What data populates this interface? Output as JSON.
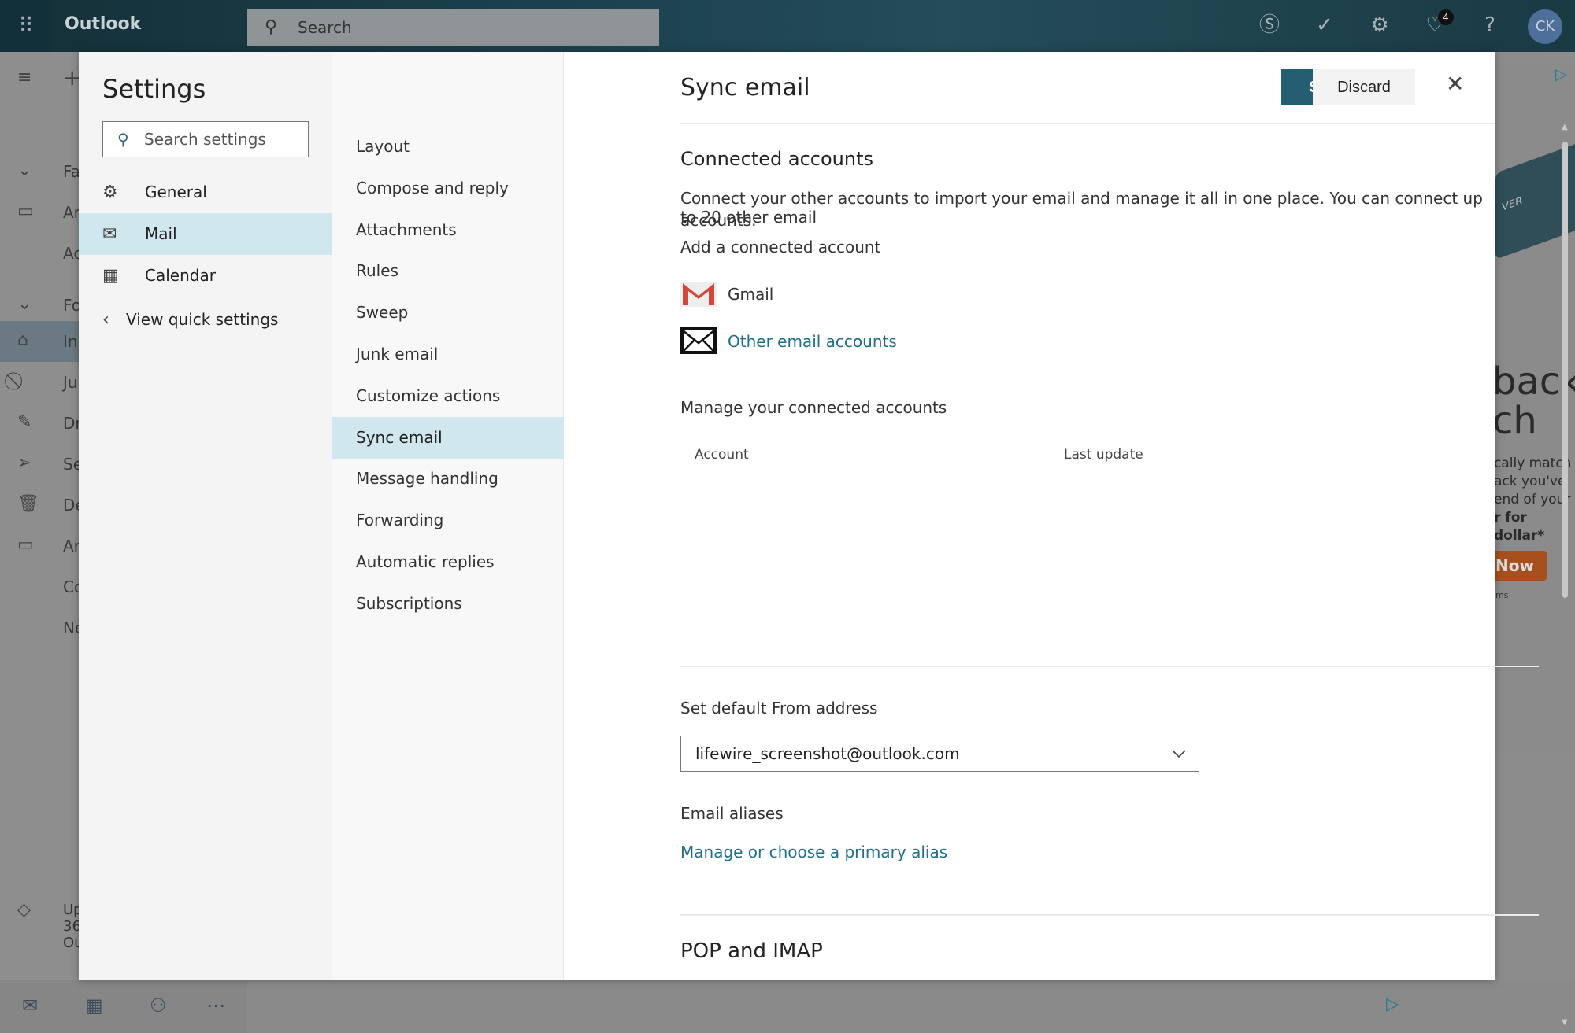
{
  "topbar": {
    "app_name": "Outlook",
    "search_placeholder": "Search",
    "notification_count": "4",
    "avatar_initials": "CK"
  },
  "background_nav": [
    {
      "icon": "chevron-down-icon",
      "label": "Fa"
    },
    {
      "icon": "archive-icon",
      "label": "Ar"
    },
    {
      "icon": "",
      "label": "Ac"
    },
    {
      "icon": "chevron-down-icon",
      "label": "Fo"
    },
    {
      "icon": "inbox-icon",
      "label": "In"
    },
    {
      "icon": "block-icon",
      "label": "Ju"
    },
    {
      "icon": "pencil-icon",
      "label": "Dr"
    },
    {
      "icon": "send-icon",
      "label": "Se"
    },
    {
      "icon": "trash-icon",
      "label": "De"
    },
    {
      "icon": "archive-icon",
      "label": "Ar"
    },
    {
      "icon": "",
      "label": "Co"
    },
    {
      "icon": "",
      "label": "Ne"
    }
  ],
  "upgrade": {
    "lines": [
      "Up",
      "36",
      "Ou"
    ]
  },
  "ad": {
    "headline": [
      "back",
      "ch"
    ],
    "body": [
      "cally match",
      "ack you've",
      "end of your",
      "r for dollar*"
    ],
    "cta": "Now",
    "terms": "ms",
    "card_text": "VER"
  },
  "settings": {
    "title": "Settings",
    "search_placeholder": "Search settings",
    "categories": [
      {
        "label": "General",
        "icon": "gear-icon"
      },
      {
        "label": "Mail",
        "icon": "mail-icon",
        "selected": true
      },
      {
        "label": "Calendar",
        "icon": "calendar-icon"
      }
    ],
    "view_quick_settings": "View quick settings",
    "mail_sections": [
      "Layout",
      "Compose and reply",
      "Attachments",
      "Rules",
      "Sweep",
      "Junk email",
      "Customize actions",
      "Sync email",
      "Message handling",
      "Forwarding",
      "Automatic replies",
      "Subscriptions"
    ],
    "selected_section": "Sync email"
  },
  "content": {
    "title": "Sync email",
    "save": "Save",
    "discard": "Discard",
    "connected_header": "Connected accounts",
    "connected_desc_1": "Connect your other accounts to import your email and manage it all in one place. You can connect up to 20 other email",
    "connected_desc_2": "accounts.",
    "add_account": "Add a connected account",
    "gmail": "Gmail",
    "other_accounts": "Other email accounts",
    "manage_header": "Manage your connected accounts",
    "table_columns": [
      "Account",
      "Last update"
    ],
    "from_label": "Set default From address",
    "from_value": "lifewire_screenshot@outlook.com",
    "aliases_label": "Email aliases",
    "aliases_link": "Manage or choose a primary alias",
    "pop_header": "POP and IMAP"
  },
  "colors": {
    "accent": "#255e73",
    "selected": "#d1e7ee",
    "link": "#1f6e8c",
    "gmail_red": "#d44638"
  }
}
